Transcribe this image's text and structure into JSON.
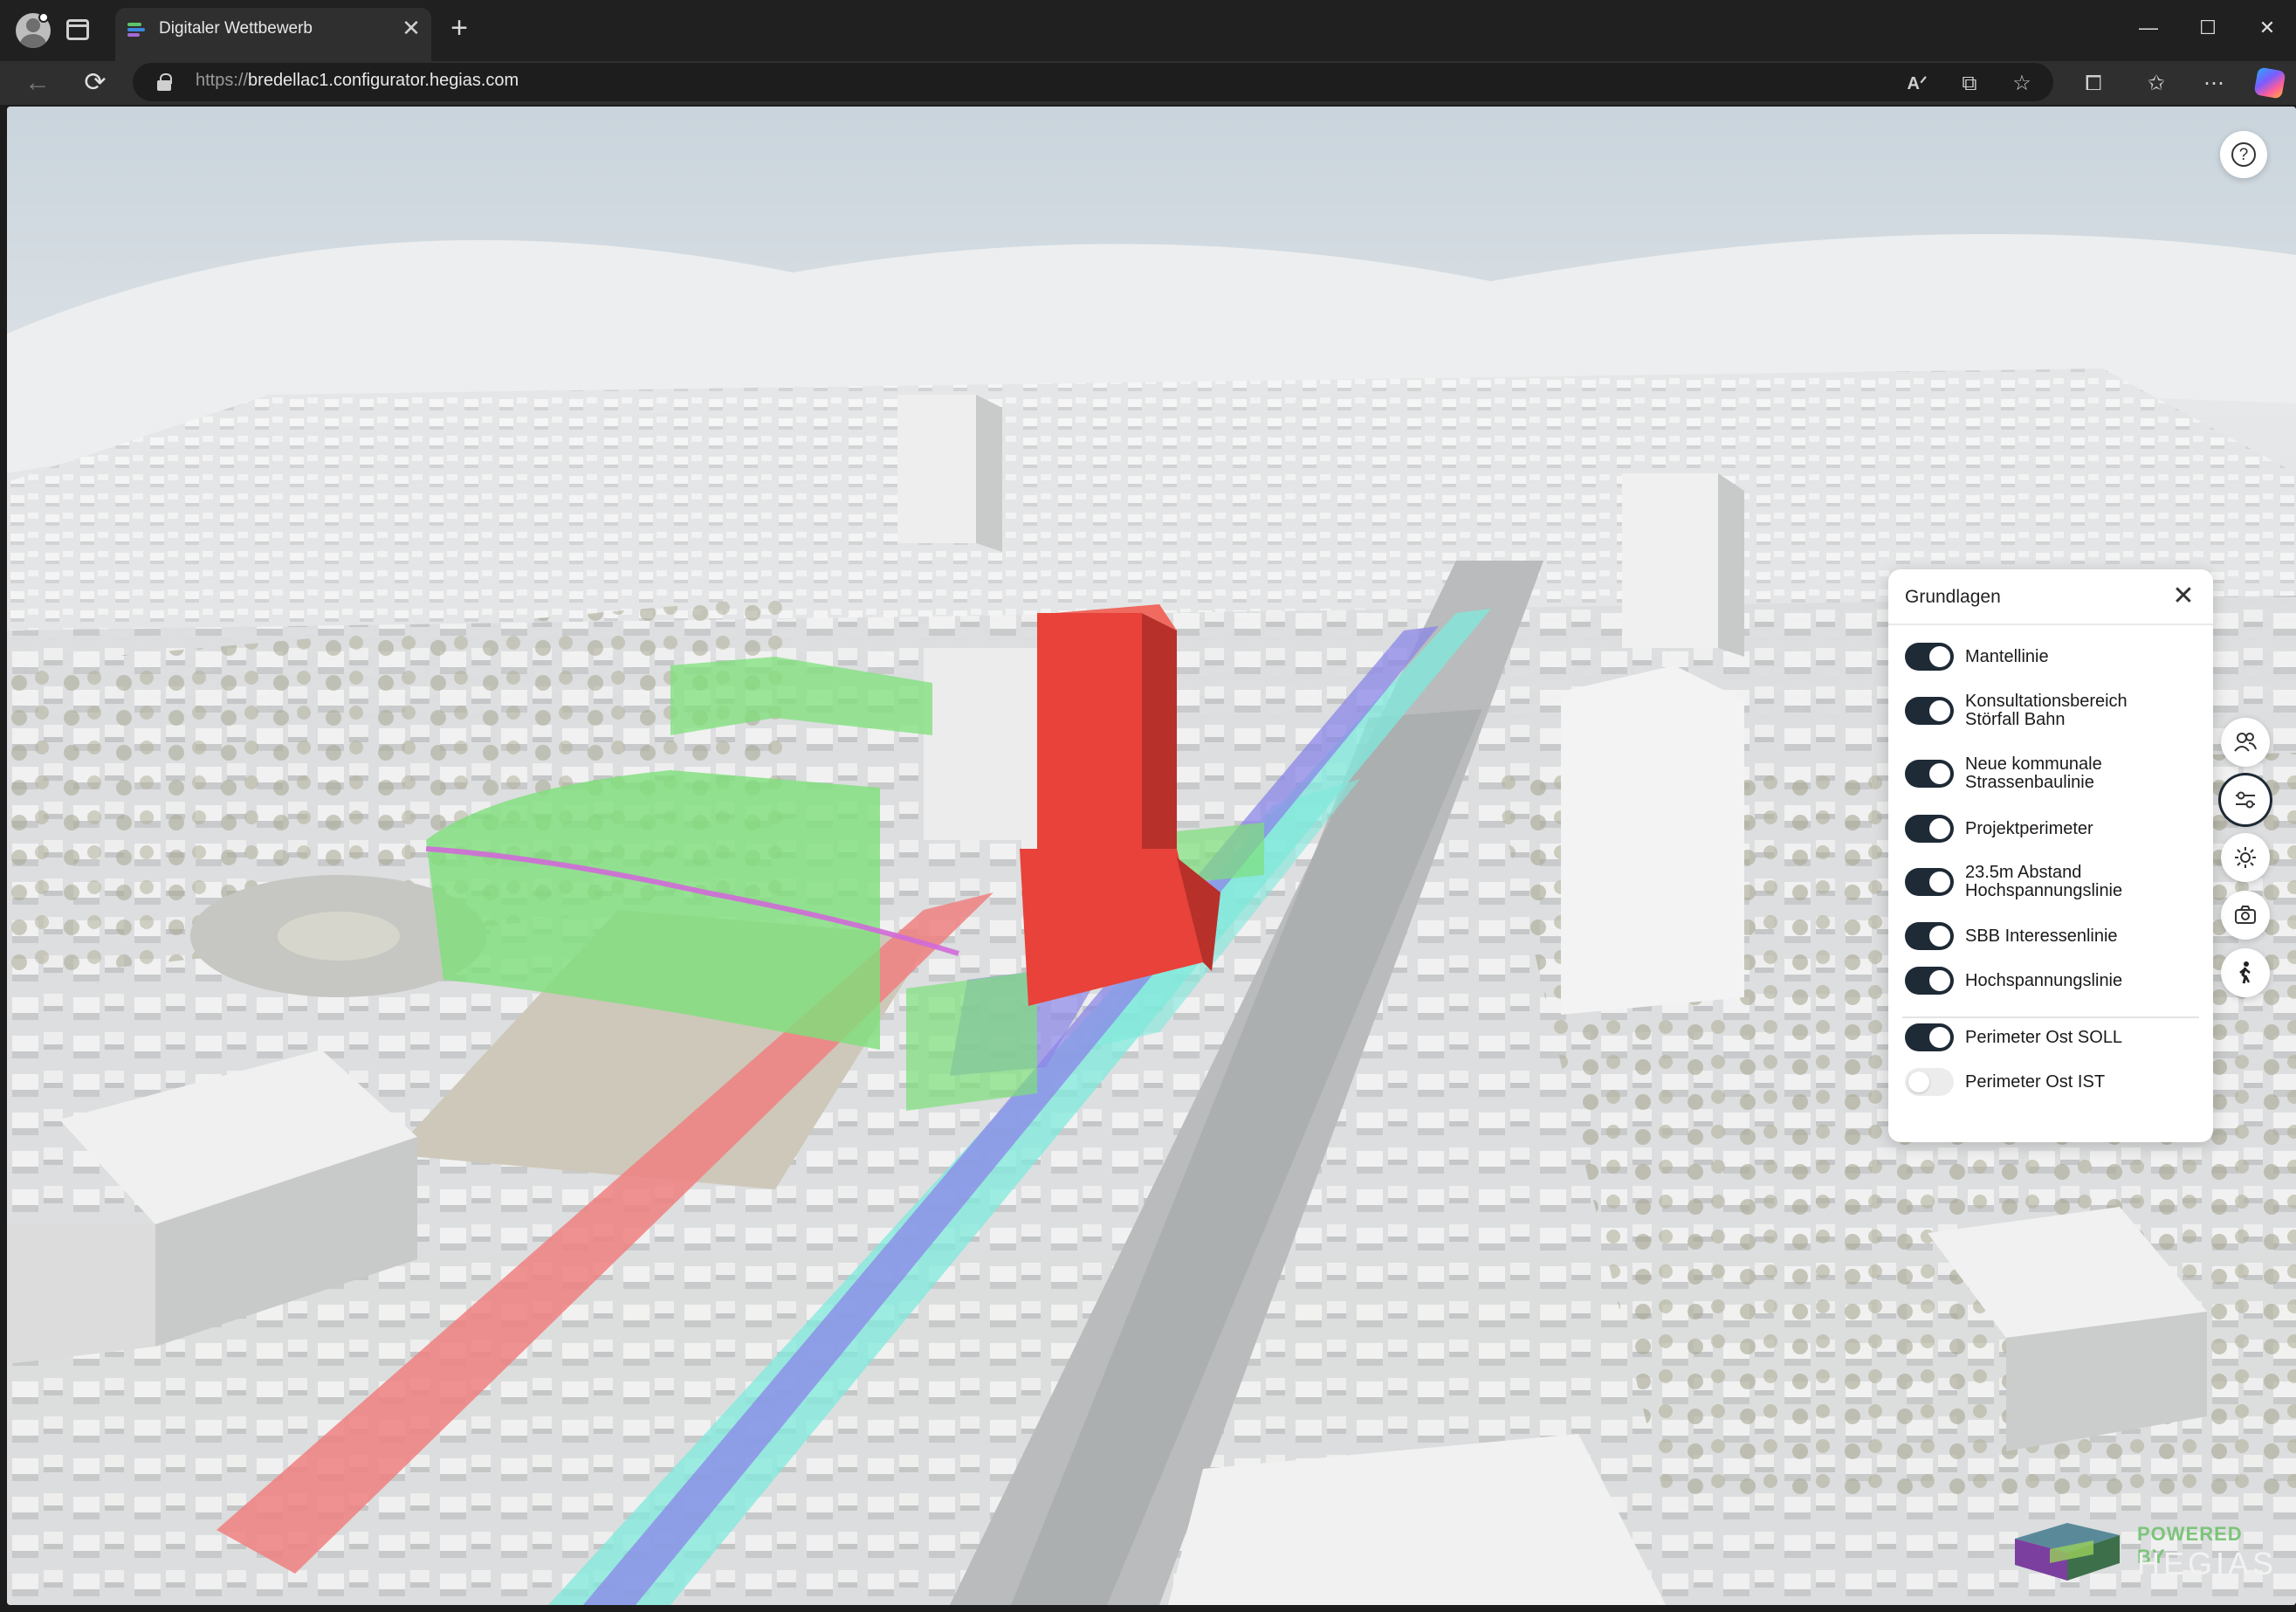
{
  "browser": {
    "tab_title": "Digitaler Wettbewerb",
    "url_protocol": "https://",
    "url_host": "bredellac1.configurator.hegias.com",
    "new_tab_label": "+",
    "close_tab_label": "✕",
    "window_controls": {
      "minimize": "—",
      "maximize": "☐",
      "close": "✕"
    },
    "nav": {
      "back": "←",
      "reload": "⟳"
    },
    "toolbar_icons": [
      "read-aloud-icon",
      "app-available-icon",
      "favorite-star-icon",
      "extensions-icon",
      "favorites-icon",
      "more-icon",
      "copilot-icon"
    ]
  },
  "viewer": {
    "help_label": "?",
    "tools": [
      "people-icon",
      "layers-sliders-icon",
      "sun-icon",
      "camera-icon",
      "walk-icon"
    ],
    "active_tool": "layers-sliders-icon"
  },
  "panel": {
    "title": "Grundlagen",
    "close_label": "✕",
    "layers": [
      {
        "label_lines": [
          "Mantellinie"
        ],
        "enabled": true
      },
      {
        "label_lines": [
          "Konsultationsbereich",
          "Störfall Bahn"
        ],
        "enabled": true
      },
      {
        "label_lines": [
          "Neue kommunale",
          "Strassenbaulinie"
        ],
        "enabled": true
      },
      {
        "label_lines": [
          "Projektperimeter"
        ],
        "enabled": true
      },
      {
        "label_lines": [
          "23.5m Abstand",
          "Hochspannungslinie"
        ],
        "enabled": true
      },
      {
        "label_lines": [
          "SBB Interessenlinie"
        ],
        "enabled": true
      },
      {
        "label_lines": [
          "Hochspannungslinie"
        ],
        "enabled": true
      },
      {
        "label_lines": [
          "Perimeter Ost SOLL"
        ],
        "enabled": true
      },
      {
        "label_lines": [
          "Perimeter Ost IST"
        ],
        "enabled": false
      }
    ]
  },
  "branding": {
    "powered_by": "POWERED BY",
    "name": "HEGIAS"
  },
  "colors": {
    "toggle_on": "#1e2a36",
    "toggle_off": "#ececec",
    "layer_red": "#e8423a",
    "layer_green": "#7ee07a",
    "layer_cyan": "#7fe9dc",
    "layer_violet": "#8b86e8",
    "layer_pink": "#ff8cb8",
    "layer_salmon": "#f08080"
  }
}
